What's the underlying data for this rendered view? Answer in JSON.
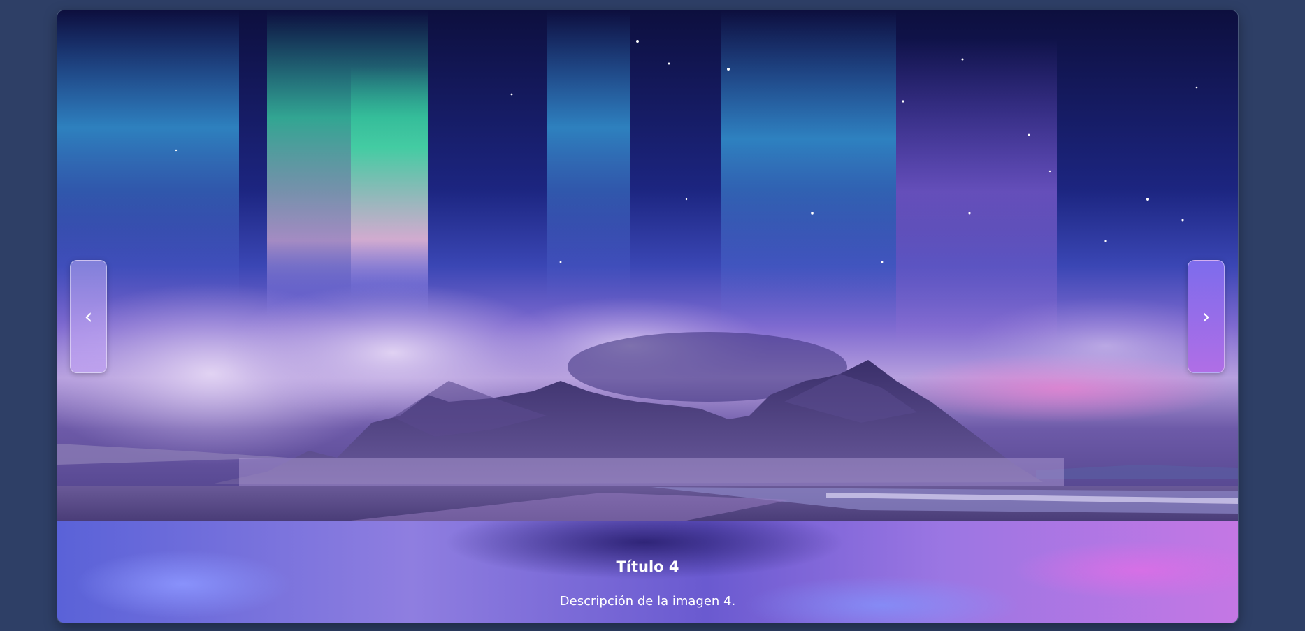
{
  "slide": {
    "title": "Título 4",
    "description": "Descripción de la imagen 4.",
    "image_subject": "aurora-over-mountains"
  },
  "nav": {
    "prev_glyph": "‹",
    "next_glyph": "›"
  },
  "colors": {
    "page_background": "#2e3f66",
    "caption_text": "#ffffff",
    "next_button": "#9b6eea"
  }
}
